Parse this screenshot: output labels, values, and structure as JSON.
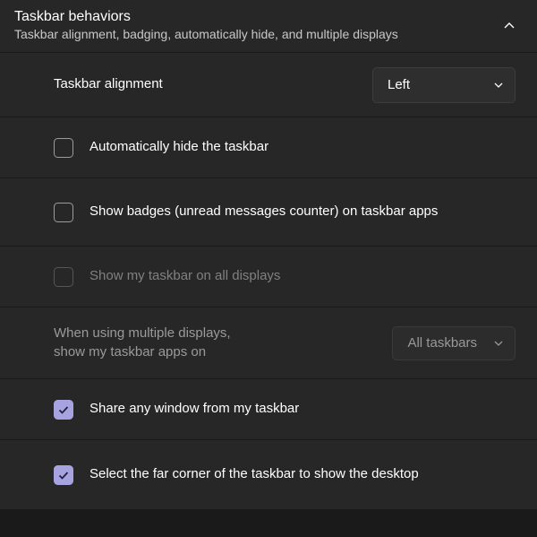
{
  "header": {
    "title": "Taskbar behaviors",
    "subtitle": "Taskbar alignment, badging, automatically hide, and multiple displays"
  },
  "alignment": {
    "label": "Taskbar alignment",
    "value": "Left"
  },
  "autohide": {
    "label": "Automatically hide the taskbar",
    "checked": false
  },
  "badges": {
    "label": "Show badges (unread messages counter) on taskbar apps",
    "checked": false
  },
  "allDisplays": {
    "label": "Show my taskbar on all displays",
    "checked": false
  },
  "multiDisplays": {
    "label_line1": "When using multiple displays,",
    "label_line2": "show my taskbar apps on",
    "value": "All taskbars"
  },
  "shareWindow": {
    "label": "Share any window from my taskbar",
    "checked": true
  },
  "farCorner": {
    "label": "Select the far corner of the taskbar to show the desktop",
    "checked": true
  }
}
